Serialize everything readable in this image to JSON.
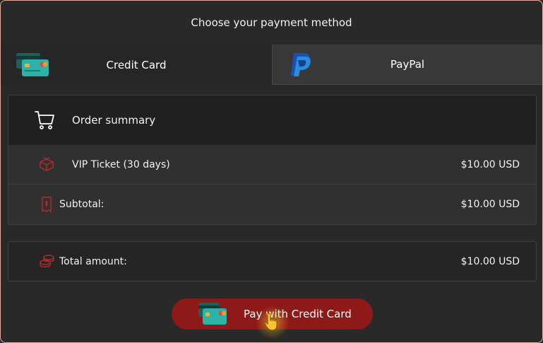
{
  "header": {
    "title": "Choose your payment method"
  },
  "tabs": [
    {
      "label": "Credit Card",
      "icon": "credit-card-icon",
      "active": true
    },
    {
      "label": "PayPal",
      "icon": "paypal-logo-icon",
      "active": false
    }
  ],
  "summary": {
    "heading": "Order summary",
    "items": [
      {
        "label": "VIP Ticket (30 days)",
        "value": "$10.00 USD",
        "icon": "gift-icon"
      }
    ],
    "subtotal": {
      "label": "Subtotal:",
      "value": "$10.00 USD",
      "icon": "receipt-icon"
    }
  },
  "total": {
    "label": "Total amount:",
    "value": "$10.00 USD",
    "icon": "coins-icon"
  },
  "pay_button": {
    "label": "Pay with Credit Card",
    "icon": "credit-card-icon"
  },
  "colors": {
    "accent": "#8d1919",
    "icon_red": "#b52a2a",
    "background": "#292929"
  }
}
